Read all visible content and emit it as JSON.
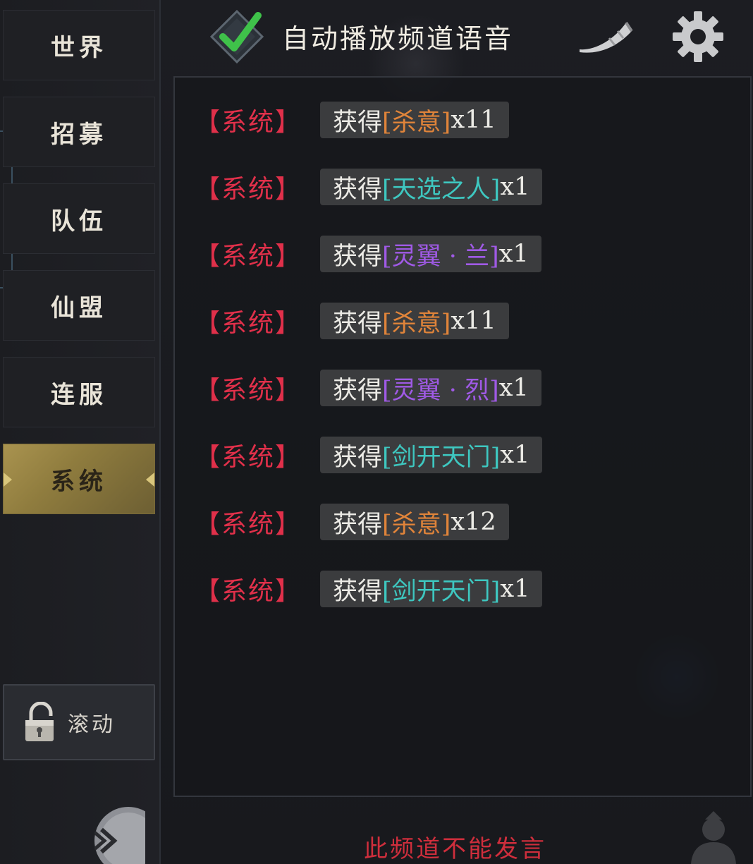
{
  "sidebar": {
    "tabs": [
      {
        "label": "世界"
      },
      {
        "label": "招募"
      },
      {
        "label": "队伍"
      },
      {
        "label": "仙盟"
      },
      {
        "label": "连服"
      },
      {
        "label": "系统",
        "active": true
      }
    ],
    "scroll_label": "滚动"
  },
  "topbar": {
    "title": "自动播放频道语音",
    "auto_play_checked": true,
    "icons": [
      "checkbox-check-icon",
      "horn-icon",
      "gear-icon"
    ]
  },
  "messages": [
    {
      "tag": "【系统】",
      "verb": "获得",
      "item": "[杀意]",
      "qty": "x11",
      "color": "orange"
    },
    {
      "tag": "【系统】",
      "verb": "获得",
      "item": "[天选之人]",
      "qty": "x1",
      "color": "cyan"
    },
    {
      "tag": "【系统】",
      "verb": "获得",
      "item": "[灵翼 · 兰]",
      "qty": "x1",
      "color": "purple"
    },
    {
      "tag": "【系统】",
      "verb": "获得",
      "item": "[杀意]",
      "qty": "x11",
      "color": "orange"
    },
    {
      "tag": "【系统】",
      "verb": "获得",
      "item": "[灵翼 · 烈]",
      "qty": "x1",
      "color": "purple"
    },
    {
      "tag": "【系统】",
      "verb": "获得",
      "item": "[剑开天门]",
      "qty": "x1",
      "color": "cyan"
    },
    {
      "tag": "【系统】",
      "verb": "获得",
      "item": "[杀意]",
      "qty": "x12",
      "color": "orange"
    },
    {
      "tag": "【系统】",
      "verb": "获得",
      "item": "[剑开天门]",
      "qty": "x1",
      "color": "cyan"
    }
  ],
  "footer": {
    "note": "此频道不能发言"
  },
  "colors": {
    "system_tag": "#e0304a",
    "orange_item": "#e0843a",
    "cyan_item": "#3ec7c0",
    "purple_item": "#a05ae6",
    "active_tab": "#a9934f"
  }
}
